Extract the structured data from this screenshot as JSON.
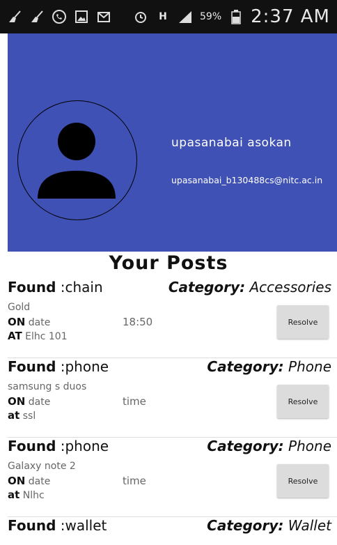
{
  "status_bar": {
    "left_icons": [
      "broom-icon",
      "broom-icon",
      "whatsapp-icon",
      "image-icon",
      "gmail-icon"
    ],
    "right_icons": [
      "alarm-icon",
      "network-h-icon",
      "signal-icon",
      "battery-icon"
    ],
    "battery": "59%",
    "time": "2:37 AM"
  },
  "profile": {
    "name": "upasanabai asokan",
    "email": "upasanabai_b130488cs@nitc.ac.in",
    "bg_color": "#3f51b5"
  },
  "section_title": "Your Posts",
  "posts": [
    {
      "found_label": "Found",
      "item": ":chain",
      "category_label": "Category:",
      "category": "Accessories",
      "description": "Gold",
      "on_label": "ON",
      "date": "date",
      "time": "18:50",
      "at_label": "AT",
      "location": "Elhc 101",
      "button": "Resolve"
    },
    {
      "found_label": "Found",
      "item": ":phone",
      "category_label": "Category:",
      "category": "Phone",
      "description": "samsung s duos",
      "on_label": "ON",
      "date": "date",
      "time": "time",
      "at_label": "at",
      "location": "ssl",
      "button": "Resolve"
    },
    {
      "found_label": "Found",
      "item": ":phone",
      "category_label": "Category:",
      "category": "Phone",
      "description": "Galaxy note 2",
      "on_label": "ON",
      "date": "date",
      "time": "time",
      "at_label": "at",
      "location": "Nlhc",
      "button": "Resolve"
    },
    {
      "found_label": "Found",
      "item": ":wallet",
      "category_label": "Category:",
      "category": "Wallet"
    }
  ]
}
